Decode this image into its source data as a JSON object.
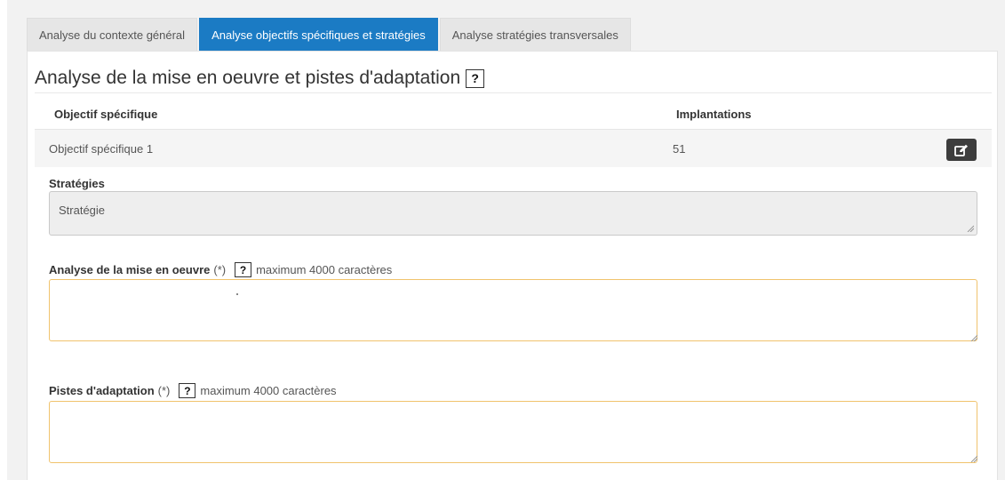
{
  "tabs": [
    {
      "label": "Analyse du contexte général",
      "active": false
    },
    {
      "label": "Analyse objectifs spécifiques et stratégies",
      "active": true
    },
    {
      "label": "Analyse stratégies transversales",
      "active": false
    }
  ],
  "section": {
    "title": "Analyse de la mise en oeuvre et pistes d'adaptation",
    "help": "?"
  },
  "table": {
    "headers": [
      "Objectif spécifique",
      "Implantations"
    ],
    "rows": [
      {
        "objectif": "Objectif spécifique 1",
        "implantations": "51",
        "action_icon": "edit-icon"
      }
    ]
  },
  "strategies": {
    "label": "Stratégies",
    "value": "Stratégie"
  },
  "analyse": {
    "label": "Analyse de la mise en oeuvre",
    "required": "(*)",
    "help": "?",
    "hint": "maximum 4000 caractères",
    "value": ""
  },
  "pistes": {
    "label": "Pistes d'adaptation",
    "required": "(*)",
    "help": "?",
    "hint": "maximum 4000 caractères",
    "value": ""
  },
  "colors": {
    "accent": "#1b7bc4",
    "focus_border": "#f0c36d",
    "edit_button": "#3d3d3d"
  }
}
